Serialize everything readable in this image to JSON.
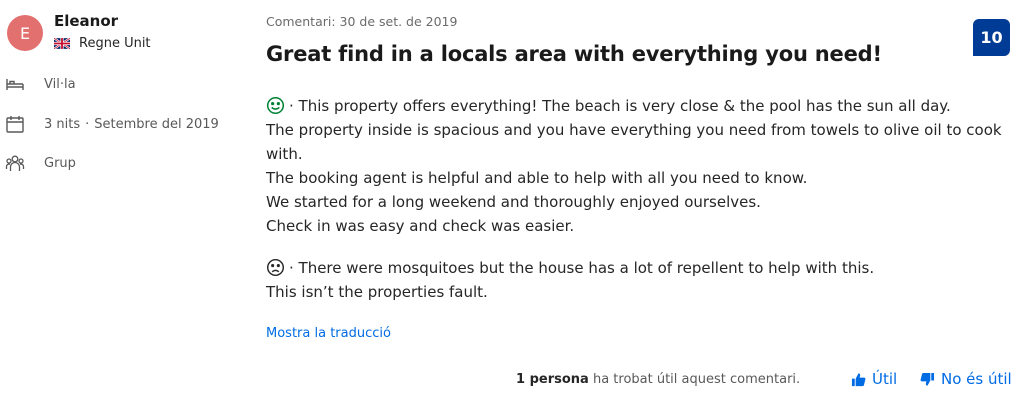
{
  "reviewer": {
    "initial": "E",
    "name": "Eleanor",
    "country": "Regne Unit",
    "flag_icon": "uk-flag-icon",
    "avatar_color": "#e2706f"
  },
  "stay": {
    "room_type": "Vil·la",
    "nights": "3 nits",
    "separator": "·",
    "period": "Setembre del 2019",
    "traveler_type": "Grup"
  },
  "review": {
    "date": "Comentari: 30 de set. de 2019",
    "title": "Great find in a locals area with everything you need!",
    "score": "10",
    "score_color": "#003b95",
    "positive_icon": "smile-icon",
    "positive_lines": [
      "· This property offers everything! The beach is very close & the pool has the sun all day.",
      "The property inside is spacious and you have everything you need from towels to olive oil to cook",
      "with.",
      "The booking agent is helpful and able to help with all you need to know.",
      "We started for a long weekend and thoroughly enjoyed ourselves.",
      "Check in was easy and check was easier."
    ],
    "negative_icon": "frown-icon",
    "negative_lines": [
      "· There were mosquitoes but the house has a lot of repellent to help with this.",
      "This isn’t the properties fault."
    ],
    "translate_link": "Mostra la traducció"
  },
  "helpful": {
    "count_bold": "1 persona",
    "count_rest": "ha trobat útil aquest comentari.",
    "yes_label": "Útil",
    "no_label": "No és útil",
    "link_color": "#006ce4"
  }
}
